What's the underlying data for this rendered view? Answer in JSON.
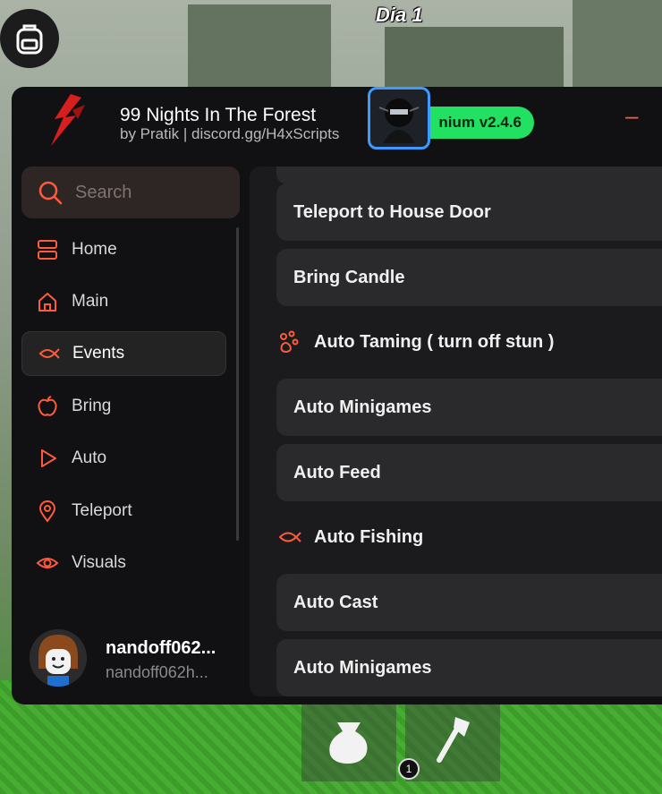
{
  "hud": {
    "day_label": "Dia 1",
    "hotbar_slot_number": "1"
  },
  "window": {
    "title": "99 Nights In The Forest",
    "subtitle": "by Pratik | discord.gg/H4xScripts",
    "badge": "nium v2.4.6",
    "accent_color": "#ff5a3c",
    "badge_color": "#22e061"
  },
  "sidebar": {
    "search_placeholder": "Search",
    "items": [
      {
        "label": "Home",
        "icon": "home-grid-icon",
        "active": false
      },
      {
        "label": "Main",
        "icon": "house-icon",
        "active": false
      },
      {
        "label": "Events",
        "icon": "fish-icon",
        "active": true
      },
      {
        "label": "Bring",
        "icon": "apple-icon",
        "active": false
      },
      {
        "label": "Auto",
        "icon": "play-icon",
        "active": false
      },
      {
        "label": "Teleport",
        "icon": "map-pin-icon",
        "active": false
      },
      {
        "label": "Visuals",
        "icon": "eye-icon",
        "active": false
      }
    ]
  },
  "user": {
    "name": "nandoff062...",
    "handle": "nandoff062h..."
  },
  "content": {
    "rows": [
      {
        "type": "button",
        "label": "Teleport to House Door"
      },
      {
        "type": "button",
        "label": "Bring Candle"
      },
      {
        "type": "section",
        "label": "Auto Taming ( turn off stun )",
        "icon": "paw-icon"
      },
      {
        "type": "button",
        "label": "Auto Minigames"
      },
      {
        "type": "button",
        "label": "Auto Feed"
      },
      {
        "type": "section",
        "label": "Auto Fishing",
        "icon": "fish-icon"
      },
      {
        "type": "button",
        "label": "Auto Cast"
      },
      {
        "type": "button",
        "label": "Auto Minigames"
      }
    ]
  }
}
